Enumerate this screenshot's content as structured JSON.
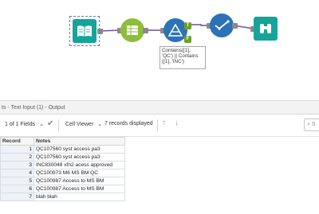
{
  "canvas": {
    "tools": [
      {
        "id": "input",
        "name": "text-input-tool"
      },
      {
        "id": "select",
        "name": "select-tool"
      },
      {
        "id": "filter",
        "name": "filter-tool"
      },
      {
        "id": "join",
        "name": "join-tool"
      },
      {
        "id": "browse",
        "name": "browse-tool"
      }
    ],
    "filter_true_anchor": "T",
    "filter_false_anchor": "F",
    "annotation": "Contains([1],\n'QC') || Contains\n([1], 'INC')",
    "colors": {
      "connection": "#6b4fa0",
      "teal": "#16a39a",
      "green": "#8dbd3b",
      "blue": "#2b73b6"
    }
  },
  "results": {
    "title": "ts - Text Input (1) - Output",
    "fields_label": "1 of 1 Fields",
    "cell_viewer_label": "Cell Viewer",
    "records_displayed": "7 records displayed",
    "search_placeholder": "S",
    "columns": [
      "Record",
      "Notes"
    ],
    "rows": [
      {
        "record": "1",
        "notes": "QC107560 syst access pa3"
      },
      {
        "record": "2",
        "notes": "QC107560 syst access pa3"
      },
      {
        "record": "3",
        "notes": "INC830048 xfn2 acess approved"
      },
      {
        "record": "4",
        "notes": "QC100973 M6 MS BM QC"
      },
      {
        "record": "5",
        "notes": "QC100987 Access to MS BM"
      },
      {
        "record": "6",
        "notes": "QC100987 Access to MS BM"
      },
      {
        "record": "7",
        "notes": "blah blah"
      }
    ]
  }
}
